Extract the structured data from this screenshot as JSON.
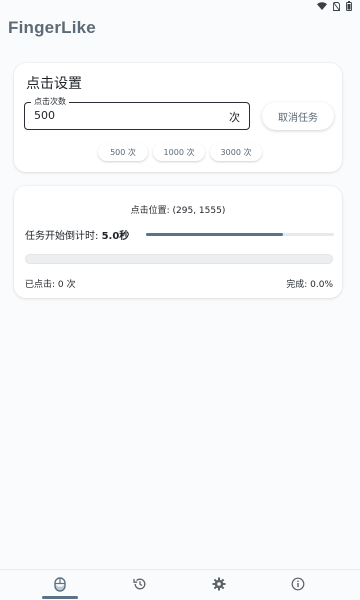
{
  "app": {
    "title": "FingerLike"
  },
  "settings": {
    "title": "点击设置",
    "count_field": {
      "label": "点击次数",
      "value": "500",
      "suffix": "次"
    },
    "cancel_label": "取消任务",
    "presets": [
      {
        "label": "500 次"
      },
      {
        "label": "1000 次"
      },
      {
        "label": "3000 次"
      }
    ]
  },
  "status": {
    "click_position": "点击位置: (295, 1555)",
    "countdown_label": "任务开始倒计时:",
    "countdown_value": "5.0秒",
    "countdown_progress": 0.73,
    "task_progress": 0,
    "clicked_text": "已点击: 0 次",
    "complete_text": "完成: 0.0%"
  },
  "nav": {
    "active": "mouse",
    "items": [
      {
        "id": "mouse",
        "icon": "mouse-icon"
      },
      {
        "id": "history",
        "icon": "history-icon"
      },
      {
        "id": "settings",
        "icon": "gear-icon"
      },
      {
        "id": "info",
        "icon": "info-icon"
      }
    ]
  },
  "colors": {
    "accent": "#5a7386",
    "title": "#5d6b78"
  }
}
